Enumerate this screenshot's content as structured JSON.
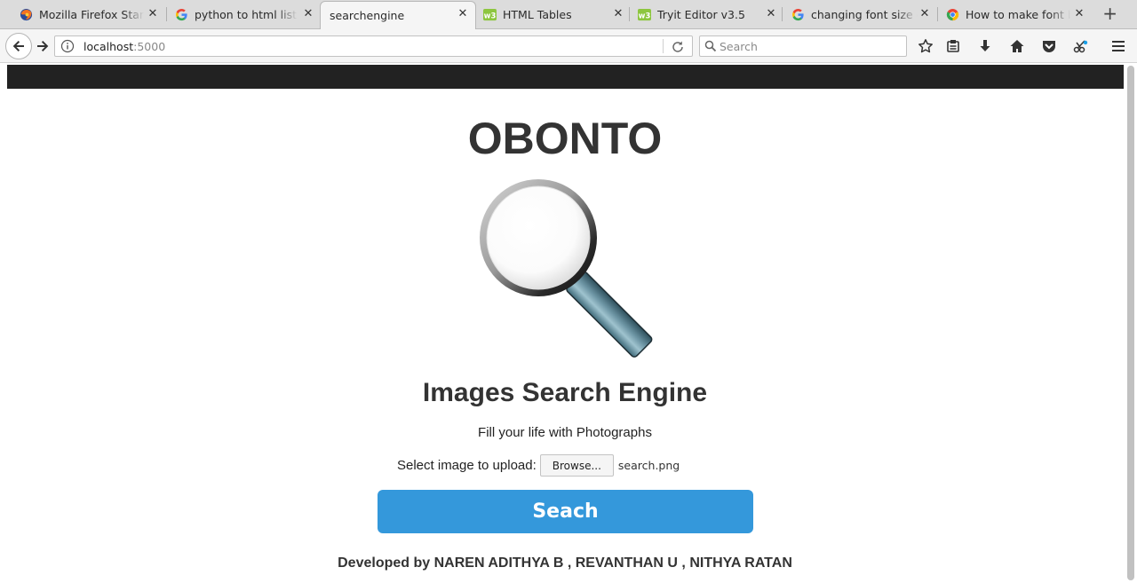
{
  "browser": {
    "tabs": [
      {
        "title": "Mozilla Firefox Start Page",
        "icon": "firefox-icon",
        "active": false
      },
      {
        "title": "python to html list - Google Search",
        "icon": "google-icon",
        "active": false
      },
      {
        "title": "searchengine",
        "icon": "",
        "active": true
      },
      {
        "title": "HTML Tables",
        "icon": "w3schools-icon",
        "active": false
      },
      {
        "title": "Tryit Editor v3.5",
        "icon": "w3schools-icon",
        "active": false
      },
      {
        "title": "changing font size google search",
        "icon": "google-icon",
        "active": false
      },
      {
        "title": "How to make font bigger",
        "icon": "chrome-icon",
        "active": false
      }
    ],
    "new_tab_label": "+",
    "close_glyph": "✕",
    "url_host": "localhost",
    "url_port": ":5000",
    "search_placeholder": "Search"
  },
  "page": {
    "brand": "OBONTO",
    "heading": "Images Search Engine",
    "tagline": "Fill your life with Photographs",
    "upload_label": "Select image to upload:",
    "browse_label": "Browse...",
    "selected_file": "search.png",
    "search_button": "Seach",
    "credits": "Developed by NAREN ADITHYA B , REVANTHAN U , NITHYA RATAN"
  },
  "colors": {
    "header_band": "#222222",
    "button_bg": "#3498db",
    "text": "#333333"
  }
}
